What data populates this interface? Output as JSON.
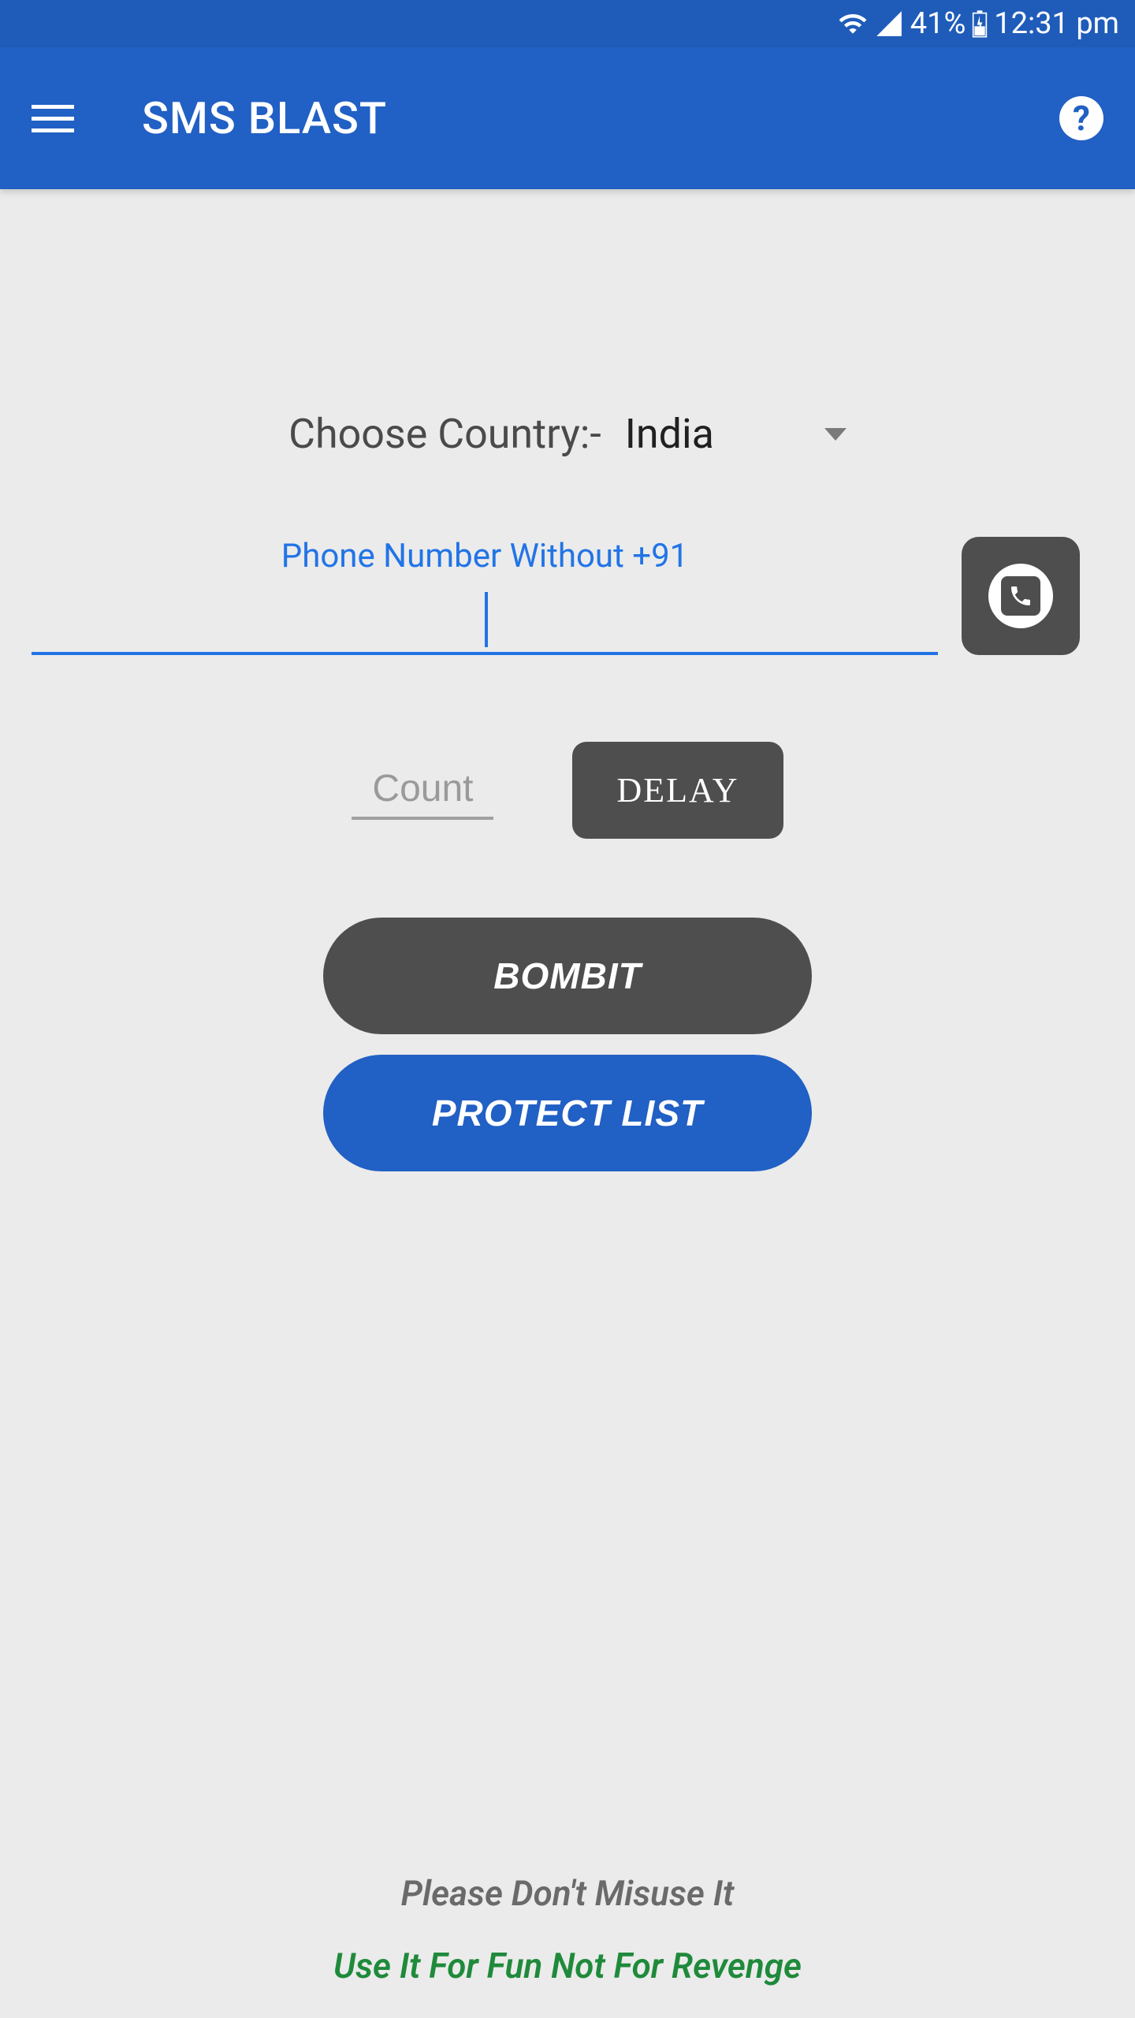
{
  "status_bar": {
    "battery": "41%",
    "time": "12:31 pm"
  },
  "app_bar": {
    "title": "SMS BLAST"
  },
  "country": {
    "label": "Choose Country:-",
    "selected": "India"
  },
  "phone": {
    "label": "Phone Number Without +91",
    "value": ""
  },
  "count": {
    "placeholder": "Count"
  },
  "delay_button_label": "DELAY",
  "bombit_button_label": "BOMBIT",
  "protect_button_label": "PROTECT LIST",
  "footer": {
    "line1": "Please Don't Misuse It",
    "line2": "Use It For Fun Not For Revenge"
  }
}
